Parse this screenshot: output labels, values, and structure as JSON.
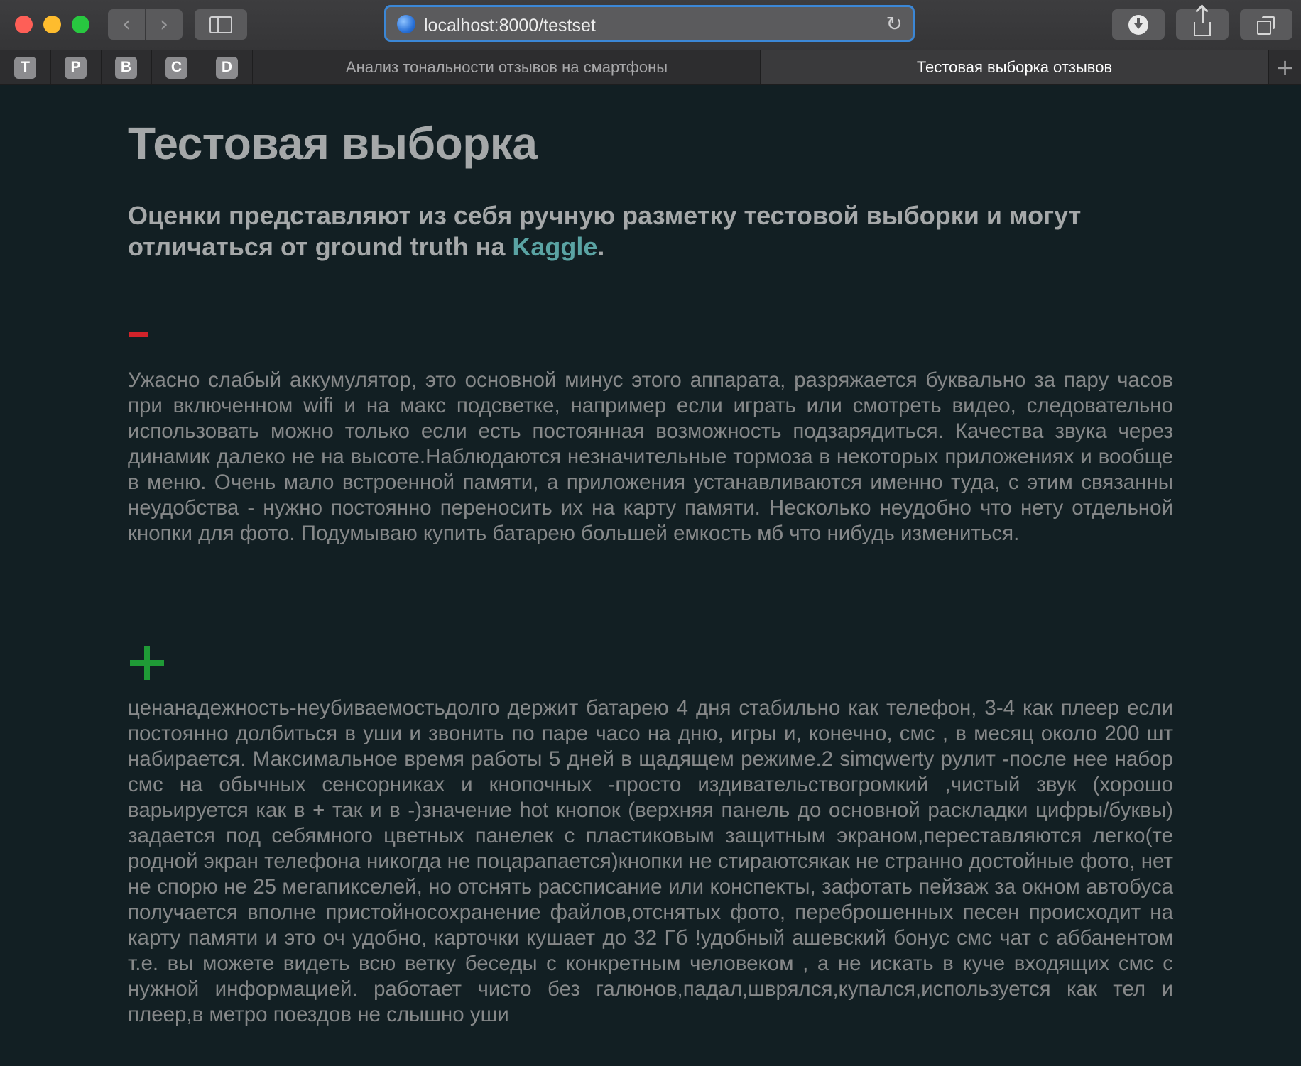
{
  "browser": {
    "url": "localhost:8000/testset",
    "pinned_tabs": [
      "T",
      "P",
      "B",
      "C",
      "D"
    ],
    "tabs": [
      {
        "label": "Анализ тональности отзывов на смартфоны",
        "active": false
      },
      {
        "label": "Тестовая выборка отзывов",
        "active": true
      }
    ],
    "new_tab_label": "+"
  },
  "page": {
    "title": "Тестовая выборка",
    "subtitle_text": "Оценки представляют из себя ручную разметку тестовой выборки и могут отличаться от ground truth на ",
    "subtitle_link": "Kaggle",
    "subtitle_end": ".",
    "reviews": [
      {
        "sentiment": "negative",
        "sentiment_color": "#d1232a",
        "text": "Ужасно слабый аккумулятор, это основной минус этого аппарата, разряжается буквально за пару часов при включенном wifi и на макс подсветке, например если играть или смотреть видео, следовательно использовать можно только если есть постоянная возможность подзарядиться. Качества звука через динамик далеко не на высоте.Наблюдаются незначительные тормоза в некоторых приложениях и вообще в меню. Очень мало встроенной памяти, а приложения устанавливаются именно туда, с этим связанны неудобства - нужно постоянно переносить их на карту памяти. Несколько неудобно что нету отдельной кнопки для фото. Подумываю купить батарею большей емкость мб что нибудь измениться."
      },
      {
        "sentiment": "positive",
        "sentiment_color": "#1f9a36",
        "text": "ценанадежность-неубиваемостьдолго держит батарею 4 дня стабильно как телефон, 3-4 как плеер если постоянно долбиться в уши и звонить по паре часо на дню, игры и, конечно, смс , в месяц около 200 шт набирается. Максимальное время работы 5 дней в щадящем режиме.2 simqwerty рулит -после нее набор смс на обычных сенсорниках и кнопочных -просто издивательствогромкий ,чистый звук (хорошо варьируется как в + так и в -)значение hot кнопок (верхняя панель до основной раскладки цифры/буквы) задается под себямного цветных панелек с пластиковым защитным экраном,переставляются легко(те родной экран телефона никогда не поцарапается)кнопки не стираютсякак не странно достойные фото, нет не спорю не 25 мегапикселей, но отснять рассписание или конспекты, зафотать пейзаж за окном автобуса получается вполне пристойносохранение файлов,отснятых фото, переброшенных песен происходит на карту памяти и это оч удобно, карточки кушает до 32 Гб !удобный ашевский бонус смс чат с аббанентом т.е. вы можете видеть всю ветку беседы с конкретным человеком , а не искать в куче входящих смс с нужной информацией. работает чисто без галюнов,падал,шврялся,купался,используется как тел и плеер,в метро поездов не слышно уши"
      }
    ]
  }
}
